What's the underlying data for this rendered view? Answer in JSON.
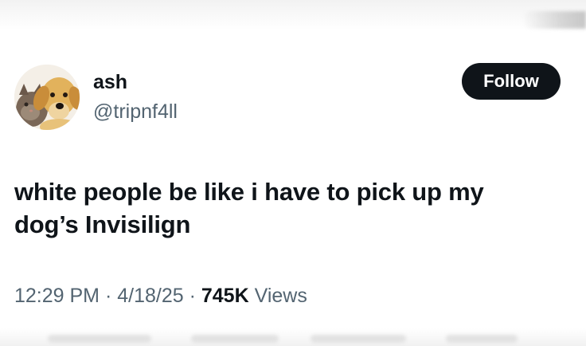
{
  "user": {
    "display_name": "ash",
    "handle": "@tripnf4ll",
    "avatar_icon": "dog-cat-avatar"
  },
  "follow_button": {
    "label": "Follow"
  },
  "tweet": {
    "line1": "white people be like i have to pick up my",
    "line2": "dog’s Invisilign"
  },
  "meta": {
    "time": "12:29 PM",
    "separator": " · ",
    "date": "4/18/25",
    "views_count": "745K",
    "views_label": "Views"
  },
  "colors": {
    "text_primary": "#0f1419",
    "text_secondary": "#536471",
    "button_bg": "#0f1419",
    "button_text": "#ffffff"
  }
}
